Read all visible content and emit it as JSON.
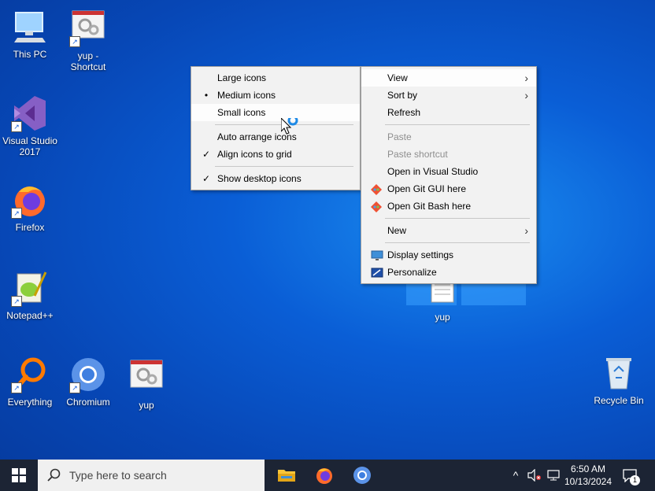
{
  "desktop_icons": {
    "this_pc": "This PC",
    "yup_shortcut_1": "yup -",
    "yup_shortcut_2": "Shortcut",
    "vs_1": "Visual Studio",
    "vs_2": "2017",
    "firefox": "Firefox",
    "notepadpp": "Notepad++",
    "everything": "Everything",
    "chromium": "Chromium",
    "yup_folder": "yup",
    "yup_doc": "yup",
    "recycle_bin": "Recycle Bin"
  },
  "view_submenu": {
    "items": [
      {
        "label": "Large icons"
      },
      {
        "label": "Medium icons",
        "mark": "•"
      },
      {
        "label": "Small icons"
      },
      {
        "label": "Auto arrange icons"
      },
      {
        "label": "Align icons to grid",
        "mark": "✓"
      },
      {
        "label": "Show desktop icons",
        "mark": "✓"
      }
    ]
  },
  "context_menu": {
    "items": [
      {
        "label": "View"
      },
      {
        "label": "Sort by"
      },
      {
        "label": "Refresh"
      },
      {
        "label": "Paste"
      },
      {
        "label": "Paste shortcut"
      },
      {
        "label": "Open in Visual Studio"
      },
      {
        "label": "Open Git GUI here"
      },
      {
        "label": "Open Git Bash here"
      },
      {
        "label": "New"
      },
      {
        "label": "Display settings"
      },
      {
        "label": "Personalize"
      }
    ]
  },
  "taskbar": {
    "search_placeholder": "Type here to search",
    "time": "6:50 AM",
    "date": "10/13/2024",
    "notification_count": "1"
  },
  "colors": {
    "accent": "#0a5ed6",
    "taskbar": "#1c2434"
  }
}
